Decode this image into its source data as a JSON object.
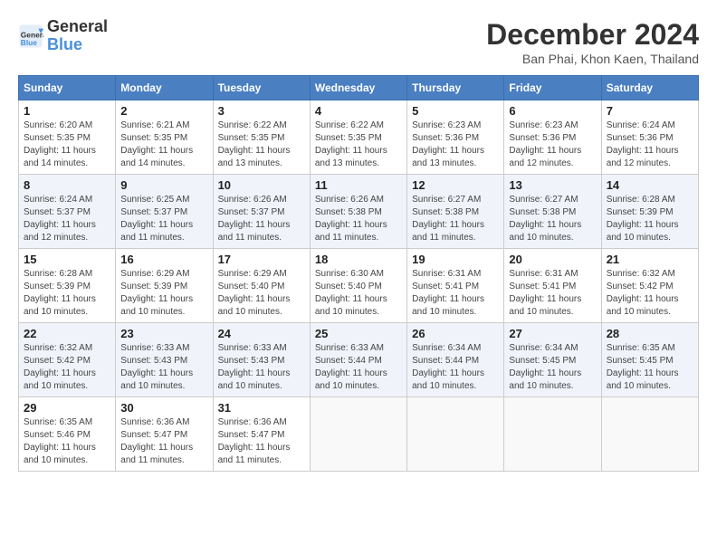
{
  "logo": {
    "line1": "General",
    "line2": "Blue"
  },
  "title": "December 2024",
  "location": "Ban Phai, Khon Kaen, Thailand",
  "weekdays": [
    "Sunday",
    "Monday",
    "Tuesday",
    "Wednesday",
    "Thursday",
    "Friday",
    "Saturday"
  ],
  "weeks": [
    [
      {
        "day": "1",
        "sunrise": "6:20 AM",
        "sunset": "5:35 PM",
        "daylight": "11 hours and 14 minutes."
      },
      {
        "day": "2",
        "sunrise": "6:21 AM",
        "sunset": "5:35 PM",
        "daylight": "11 hours and 14 minutes."
      },
      {
        "day": "3",
        "sunrise": "6:22 AM",
        "sunset": "5:35 PM",
        "daylight": "11 hours and 13 minutes."
      },
      {
        "day": "4",
        "sunrise": "6:22 AM",
        "sunset": "5:35 PM",
        "daylight": "11 hours and 13 minutes."
      },
      {
        "day": "5",
        "sunrise": "6:23 AM",
        "sunset": "5:36 PM",
        "daylight": "11 hours and 13 minutes."
      },
      {
        "day": "6",
        "sunrise": "6:23 AM",
        "sunset": "5:36 PM",
        "daylight": "11 hours and 12 minutes."
      },
      {
        "day": "7",
        "sunrise": "6:24 AM",
        "sunset": "5:36 PM",
        "daylight": "11 hours and 12 minutes."
      }
    ],
    [
      {
        "day": "8",
        "sunrise": "6:24 AM",
        "sunset": "5:37 PM",
        "daylight": "11 hours and 12 minutes."
      },
      {
        "day": "9",
        "sunrise": "6:25 AM",
        "sunset": "5:37 PM",
        "daylight": "11 hours and 11 minutes."
      },
      {
        "day": "10",
        "sunrise": "6:26 AM",
        "sunset": "5:37 PM",
        "daylight": "11 hours and 11 minutes."
      },
      {
        "day": "11",
        "sunrise": "6:26 AM",
        "sunset": "5:38 PM",
        "daylight": "11 hours and 11 minutes."
      },
      {
        "day": "12",
        "sunrise": "6:27 AM",
        "sunset": "5:38 PM",
        "daylight": "11 hours and 11 minutes."
      },
      {
        "day": "13",
        "sunrise": "6:27 AM",
        "sunset": "5:38 PM",
        "daylight": "11 hours and 10 minutes."
      },
      {
        "day": "14",
        "sunrise": "6:28 AM",
        "sunset": "5:39 PM",
        "daylight": "11 hours and 10 minutes."
      }
    ],
    [
      {
        "day": "15",
        "sunrise": "6:28 AM",
        "sunset": "5:39 PM",
        "daylight": "11 hours and 10 minutes."
      },
      {
        "day": "16",
        "sunrise": "6:29 AM",
        "sunset": "5:39 PM",
        "daylight": "11 hours and 10 minutes."
      },
      {
        "day": "17",
        "sunrise": "6:29 AM",
        "sunset": "5:40 PM",
        "daylight": "11 hours and 10 minutes."
      },
      {
        "day": "18",
        "sunrise": "6:30 AM",
        "sunset": "5:40 PM",
        "daylight": "11 hours and 10 minutes."
      },
      {
        "day": "19",
        "sunrise": "6:31 AM",
        "sunset": "5:41 PM",
        "daylight": "11 hours and 10 minutes."
      },
      {
        "day": "20",
        "sunrise": "6:31 AM",
        "sunset": "5:41 PM",
        "daylight": "11 hours and 10 minutes."
      },
      {
        "day": "21",
        "sunrise": "6:32 AM",
        "sunset": "5:42 PM",
        "daylight": "11 hours and 10 minutes."
      }
    ],
    [
      {
        "day": "22",
        "sunrise": "6:32 AM",
        "sunset": "5:42 PM",
        "daylight": "11 hours and 10 minutes."
      },
      {
        "day": "23",
        "sunrise": "6:33 AM",
        "sunset": "5:43 PM",
        "daylight": "11 hours and 10 minutes."
      },
      {
        "day": "24",
        "sunrise": "6:33 AM",
        "sunset": "5:43 PM",
        "daylight": "11 hours and 10 minutes."
      },
      {
        "day": "25",
        "sunrise": "6:33 AM",
        "sunset": "5:44 PM",
        "daylight": "11 hours and 10 minutes."
      },
      {
        "day": "26",
        "sunrise": "6:34 AM",
        "sunset": "5:44 PM",
        "daylight": "11 hours and 10 minutes."
      },
      {
        "day": "27",
        "sunrise": "6:34 AM",
        "sunset": "5:45 PM",
        "daylight": "11 hours and 10 minutes."
      },
      {
        "day": "28",
        "sunrise": "6:35 AM",
        "sunset": "5:45 PM",
        "daylight": "11 hours and 10 minutes."
      }
    ],
    [
      {
        "day": "29",
        "sunrise": "6:35 AM",
        "sunset": "5:46 PM",
        "daylight": "11 hours and 10 minutes."
      },
      {
        "day": "30",
        "sunrise": "6:36 AM",
        "sunset": "5:47 PM",
        "daylight": "11 hours and 11 minutes."
      },
      {
        "day": "31",
        "sunrise": "6:36 AM",
        "sunset": "5:47 PM",
        "daylight": "11 hours and 11 minutes."
      },
      null,
      null,
      null,
      null
    ]
  ],
  "labels": {
    "sunrise": "Sunrise:",
    "sunset": "Sunset:",
    "daylight": "Daylight:"
  }
}
